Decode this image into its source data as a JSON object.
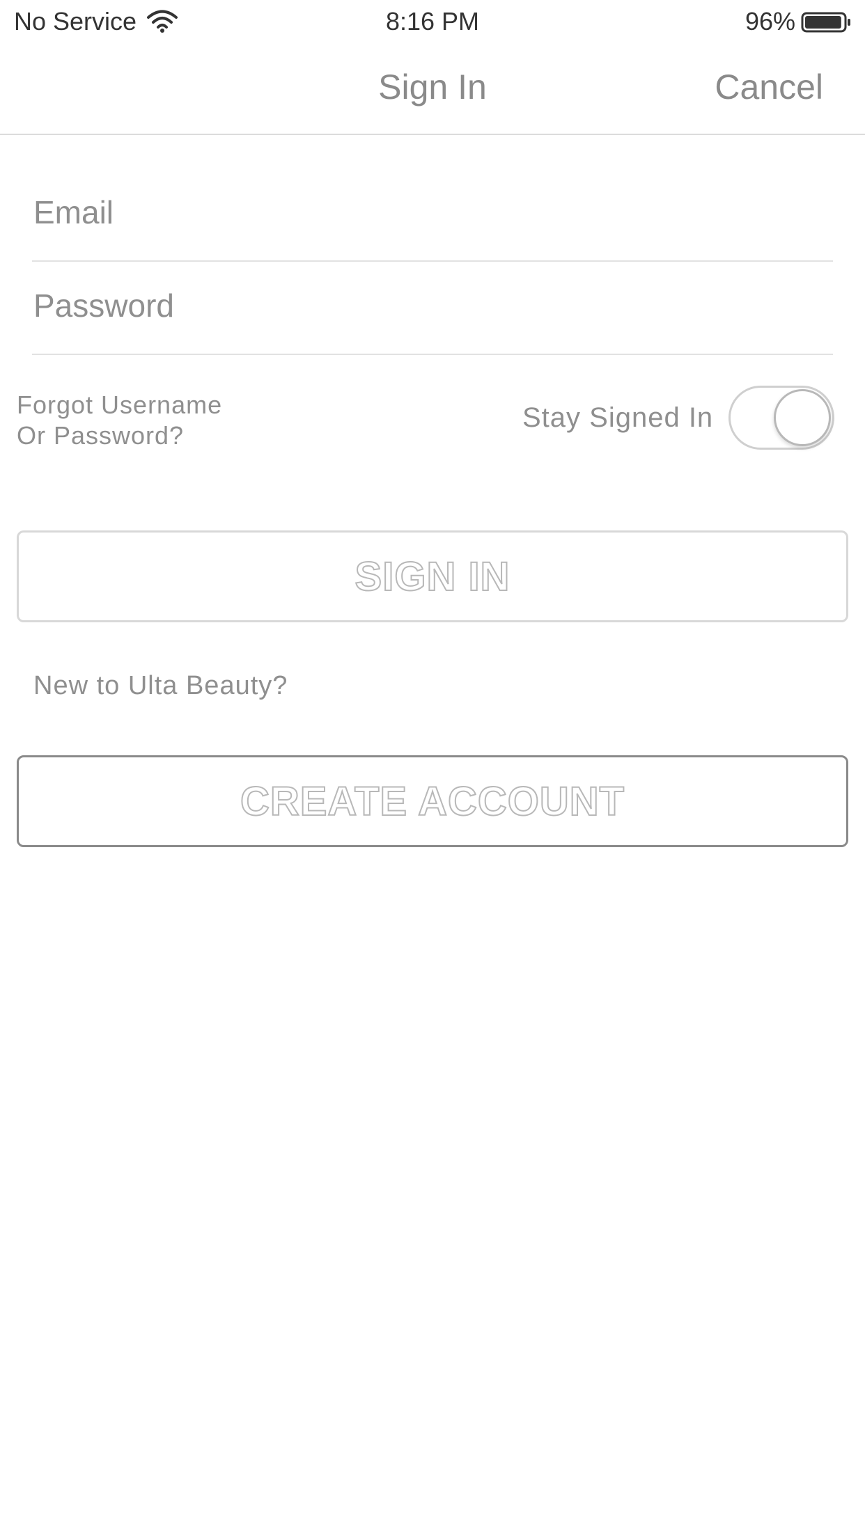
{
  "status_bar": {
    "carrier": "No Service",
    "time": "8:16 PM",
    "battery": "96%",
    "battery_level": 0.96,
    "wifi_icon": "wifi-icon",
    "battery_icon": "battery-icon"
  },
  "nav": {
    "title": "Sign In",
    "cancel_label": "Cancel"
  },
  "form": {
    "email_placeholder": "Email",
    "email_value": "",
    "password_placeholder": "Password",
    "password_value": ""
  },
  "options": {
    "forgot_line1": "Forgot Username",
    "forgot_line2": "Or Password?",
    "stay_signed_in_label": "Stay Signed In",
    "stay_signed_in_on": false
  },
  "actions": {
    "sign_in_label": "SIGN IN",
    "new_customer_text": "New to Ulta Beauty?",
    "create_account_label": "CREATE ACCOUNT"
  },
  "colors": {
    "text_muted": "#8f8f8f",
    "divider": "#e2e2e2",
    "button_text_outline": "#b8b8b8"
  }
}
